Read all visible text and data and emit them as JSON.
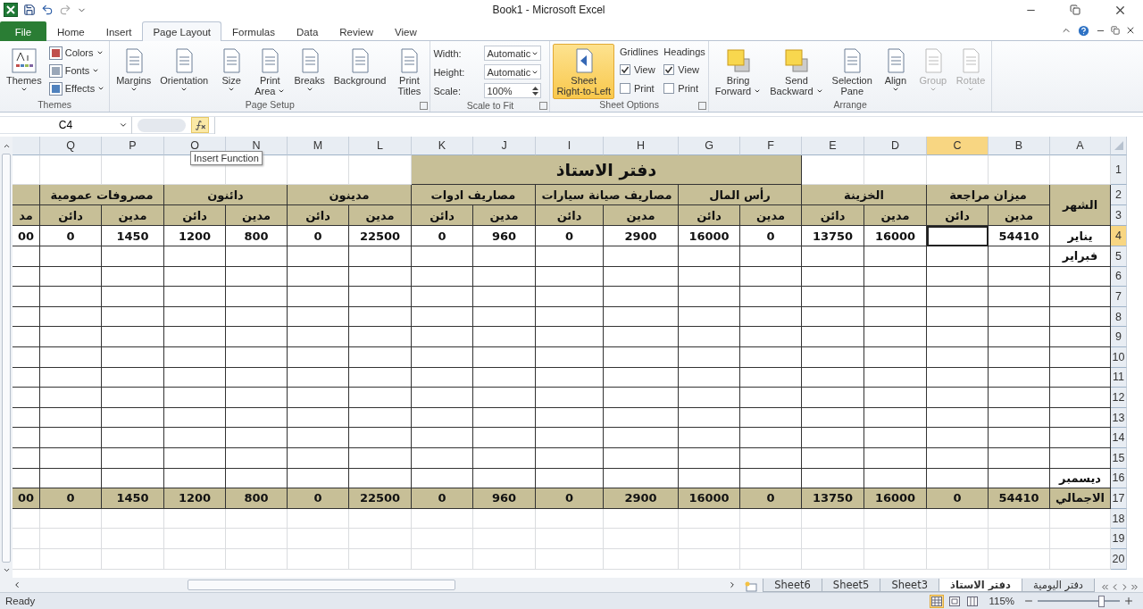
{
  "window": {
    "title": "Book1  -  Microsoft Excel"
  },
  "tabs": [
    {
      "label": "File",
      "kind": "file",
      "selected": false
    },
    {
      "label": "Home",
      "kind": "tab",
      "selected": false
    },
    {
      "label": "Insert",
      "kind": "tab",
      "selected": false
    },
    {
      "label": "Page Layout",
      "kind": "tab",
      "selected": true
    },
    {
      "label": "Formulas",
      "kind": "tab",
      "selected": false
    },
    {
      "label": "Data",
      "kind": "tab",
      "selected": false
    },
    {
      "label": "Review",
      "kind": "tab",
      "selected": false
    },
    {
      "label": "View",
      "kind": "tab",
      "selected": false
    }
  ],
  "ribbon": {
    "groups": [
      {
        "label": "Themes",
        "launcher": false,
        "controls": [
          {
            "kind": "large",
            "lines": [
              "Themes"
            ],
            "dropdown": true,
            "selected": false,
            "disabled": false
          },
          {
            "kind": "stack",
            "items": [
              {
                "label": "Colors",
                "dropdown": true
              },
              {
                "label": "Fonts",
                "dropdown": true
              },
              {
                "label": "Effects",
                "dropdown": true
              }
            ]
          }
        ]
      },
      {
        "label": "Page Setup",
        "launcher": true,
        "controls": [
          {
            "kind": "large",
            "lines": [
              "Margins"
            ],
            "dropdown": true,
            "selected": false,
            "disabled": false
          },
          {
            "kind": "large",
            "lines": [
              "Orientation"
            ],
            "dropdown": true,
            "selected": false,
            "disabled": false
          },
          {
            "kind": "large",
            "lines": [
              "Size"
            ],
            "dropdown": true,
            "selected": false,
            "disabled": false
          },
          {
            "kind": "large",
            "lines": [
              "Print",
              "Area"
            ],
            "dropdown": true,
            "selected": false,
            "disabled": false
          },
          {
            "kind": "large",
            "lines": [
              "Breaks"
            ],
            "dropdown": true,
            "selected": false,
            "disabled": false
          },
          {
            "kind": "large",
            "lines": [
              "Background"
            ],
            "dropdown": false,
            "selected": false,
            "disabled": false
          },
          {
            "kind": "large",
            "lines": [
              "Print",
              "Titles"
            ],
            "dropdown": false,
            "selected": false,
            "disabled": false
          }
        ]
      },
      {
        "label": "Scale to Fit",
        "launcher": true,
        "controls": [
          {
            "kind": "fields",
            "items": [
              {
                "label": "Width:",
                "value": "Automatic",
                "kind": "dropdown"
              },
              {
                "label": "Height:",
                "value": "Automatic",
                "kind": "dropdown"
              },
              {
                "label": "Scale:",
                "value": "100%",
                "kind": "spinner"
              }
            ]
          }
        ]
      },
      {
        "label": "Sheet Options",
        "launcher": true,
        "controls": [
          {
            "kind": "large",
            "lines": [
              "Sheet",
              "Right-to-Left"
            ],
            "dropdown": false,
            "selected": true,
            "disabled": false
          },
          {
            "kind": "checks",
            "heading": "Gridlines",
            "items": [
              {
                "label": "View",
                "checked": true
              },
              {
                "label": "Print",
                "checked": false
              }
            ]
          },
          {
            "kind": "checks",
            "heading": "Headings",
            "items": [
              {
                "label": "View",
                "checked": true
              },
              {
                "label": "Print",
                "checked": false
              }
            ]
          }
        ]
      },
      {
        "label": "Arrange",
        "launcher": false,
        "controls": [
          {
            "kind": "large",
            "lines": [
              "Bring",
              "Forward"
            ],
            "dropdown": true,
            "selected": false,
            "disabled": false
          },
          {
            "kind": "large",
            "lines": [
              "Send",
              "Backward"
            ],
            "dropdown": true,
            "selected": false,
            "disabled": false
          },
          {
            "kind": "large",
            "lines": [
              "Selection",
              "Pane"
            ],
            "dropdown": false,
            "selected": false,
            "disabled": false
          },
          {
            "kind": "large",
            "lines": [
              "Align"
            ],
            "dropdown": true,
            "selected": false,
            "disabled": false
          },
          {
            "kind": "large",
            "lines": [
              "Group"
            ],
            "dropdown": true,
            "selected": false,
            "disabled": true
          },
          {
            "kind": "large",
            "lines": [
              "Rotate"
            ],
            "dropdown": true,
            "selected": false,
            "disabled": true
          }
        ]
      }
    ]
  },
  "formula_bar": {
    "name_box": "C4"
  },
  "tooltip": "Insert Function",
  "sheet": {
    "columns": [
      {
        "label": "Q",
        "selected": false
      },
      {
        "label": "P",
        "selected": false
      },
      {
        "label": "O",
        "selected": false
      },
      {
        "label": "N",
        "selected": false
      },
      {
        "label": "M",
        "selected": false
      },
      {
        "label": "L",
        "selected": false
      },
      {
        "label": "K",
        "selected": false
      },
      {
        "label": "J",
        "selected": false
      },
      {
        "label": "I",
        "selected": false
      },
      {
        "label": "H",
        "selected": false
      },
      {
        "label": "G",
        "selected": false
      },
      {
        "label": "F",
        "selected": false
      },
      {
        "label": "E",
        "selected": false
      },
      {
        "label": "D",
        "selected": false
      },
      {
        "label": "C",
        "selected": true
      },
      {
        "label": "B",
        "selected": false
      },
      {
        "label": "A",
        "selected": false
      }
    ],
    "rows": [
      {
        "label": "1",
        "selected": false,
        "kind": "title",
        "title": "دفتر الاستاذ"
      },
      {
        "label": "2",
        "selected": false,
        "kind": "group_header",
        "month": "الشهر",
        "groups": [
          "ميزان مراجعة",
          "الخزينة",
          "رأس المال",
          "مصاريف صيانة سيارات",
          "مصاريف ادوات",
          "مدينون",
          "دائنون",
          "مصروفات عمومية"
        ]
      },
      {
        "label": "3",
        "selected": false,
        "kind": "sub_header",
        "cells": [
          "مدين",
          "دائن",
          "مدين",
          "دائن",
          "مدين",
          "دائن",
          "مدين",
          "دائن",
          "مدين",
          "دائن",
          "مدين",
          "دائن",
          "مدين",
          "دائن",
          "مدين",
          "دائن",
          "مد"
        ]
      },
      {
        "label": "4",
        "selected": true,
        "kind": "data",
        "cells": [
          "00",
          "0",
          "1450",
          "1200",
          "800",
          "0",
          "22500",
          "0",
          "960",
          "0",
          "2900",
          "16000",
          "0",
          "13750",
          "16000",
          null,
          "54410"
        ],
        "month": "يناير"
      },
      {
        "label": "5",
        "selected": false,
        "kind": "data",
        "month": "فبراير"
      },
      {
        "label": "6",
        "selected": false,
        "kind": "data"
      },
      {
        "label": "7",
        "selected": false,
        "kind": "data"
      },
      {
        "label": "8",
        "selected": false,
        "kind": "data"
      },
      {
        "label": "9",
        "selected": false,
        "kind": "data"
      },
      {
        "label": "10",
        "selected": false,
        "kind": "data"
      },
      {
        "label": "11",
        "selected": false,
        "kind": "data"
      },
      {
        "label": "12",
        "selected": false,
        "kind": "data"
      },
      {
        "label": "13",
        "selected": false,
        "kind": "data"
      },
      {
        "label": "14",
        "selected": false,
        "kind": "data"
      },
      {
        "label": "15",
        "selected": false,
        "kind": "data"
      },
      {
        "label": "16",
        "selected": false,
        "kind": "data",
        "month": "ديسمبر"
      },
      {
        "label": "17",
        "selected": false,
        "kind": "total",
        "cells": [
          "00",
          "0",
          "1450",
          "1200",
          "800",
          "0",
          "22500",
          "0",
          "960",
          "0",
          "2900",
          "16000",
          "0",
          "13750",
          "16000",
          "0",
          "54410"
        ],
        "month": "الاجمالي"
      },
      {
        "label": "18",
        "selected": false,
        "kind": "empty"
      },
      {
        "label": "19",
        "selected": false,
        "kind": "empty"
      },
      {
        "label": "20",
        "selected": false,
        "kind": "empty"
      }
    ]
  },
  "sheet_tabs": [
    {
      "label": "Sheet6",
      "selected": false
    },
    {
      "label": "Sheet5",
      "selected": false
    },
    {
      "label": "Sheet3",
      "selected": false
    },
    {
      "label": "دفتر الاستاذ",
      "selected": true
    },
    {
      "label": "دفتر اليومية",
      "selected": false
    }
  ],
  "status_bar": {
    "status": "Ready",
    "views": [
      {
        "selected": true
      },
      {
        "selected": false
      },
      {
        "selected": false
      }
    ],
    "zoom": "115%",
    "zoom_slider": {
      "level": 0.8
    }
  }
}
